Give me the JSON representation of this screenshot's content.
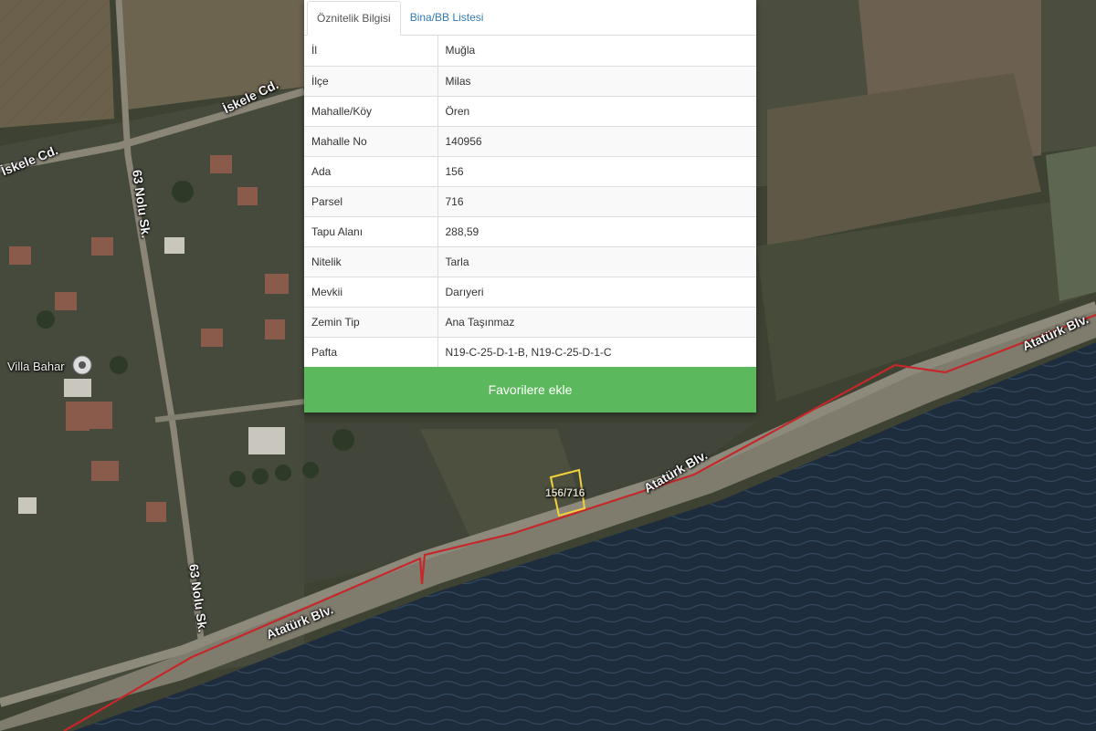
{
  "tabs": [
    {
      "label": "Öznitelik Bilgisi",
      "active": true
    },
    {
      "label": "Bina/BB Listesi",
      "active": false
    }
  ],
  "attributes": [
    {
      "key": "İl",
      "value": "Muğla"
    },
    {
      "key": "İlçe",
      "value": "Milas"
    },
    {
      "key": "Mahalle/Köy",
      "value": "Ören"
    },
    {
      "key": "Mahalle No",
      "value": "140956"
    },
    {
      "key": "Ada",
      "value": "156"
    },
    {
      "key": "Parsel",
      "value": "716"
    },
    {
      "key": "Tapu Alanı",
      "value": "288,59"
    },
    {
      "key": "Nitelik",
      "value": "Tarla"
    },
    {
      "key": "Mevkii",
      "value": "Darıyeri"
    },
    {
      "key": "Zemin Tip",
      "value": "Ana Taşınmaz"
    },
    {
      "key": "Pafta",
      "value": "N19-C-25-D-1-B, N19-C-25-D-1-C"
    }
  ],
  "favorite_button": "Favorilere ekle",
  "map": {
    "parcel_label": "156/716",
    "poi_label": "Villa Bahar",
    "road_labels": [
      "İskele Cd.",
      "İskele Cd.",
      "63 Nolu Sk.",
      "63 Nolu Sk.",
      "Atatürk Blv.",
      "Atatürk Blv.",
      "Atatürk Blv."
    ],
    "colors": {
      "boundary": "#c4282a",
      "parcel": "#f2d23c",
      "sea": "#1e2d3e",
      "button": "#5cb85c",
      "tab_link": "#337ab7"
    }
  }
}
